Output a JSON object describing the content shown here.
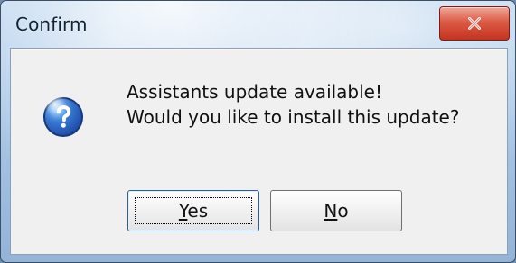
{
  "window": {
    "title": "Confirm"
  },
  "icons": {
    "close": "close-icon",
    "question": "question-icon"
  },
  "message": {
    "line1": "Assistants update available!",
    "line2": "Would you like to install this update?"
  },
  "buttons": {
    "yes": {
      "mnemonic": "Y",
      "rest": "es"
    },
    "no": {
      "mnemonic": "N",
      "rest": "o"
    }
  },
  "colors": {
    "closeRed": "#c5331f",
    "questionBlue": "#1f4ea8",
    "dialogBg": "#f0f0f0"
  }
}
